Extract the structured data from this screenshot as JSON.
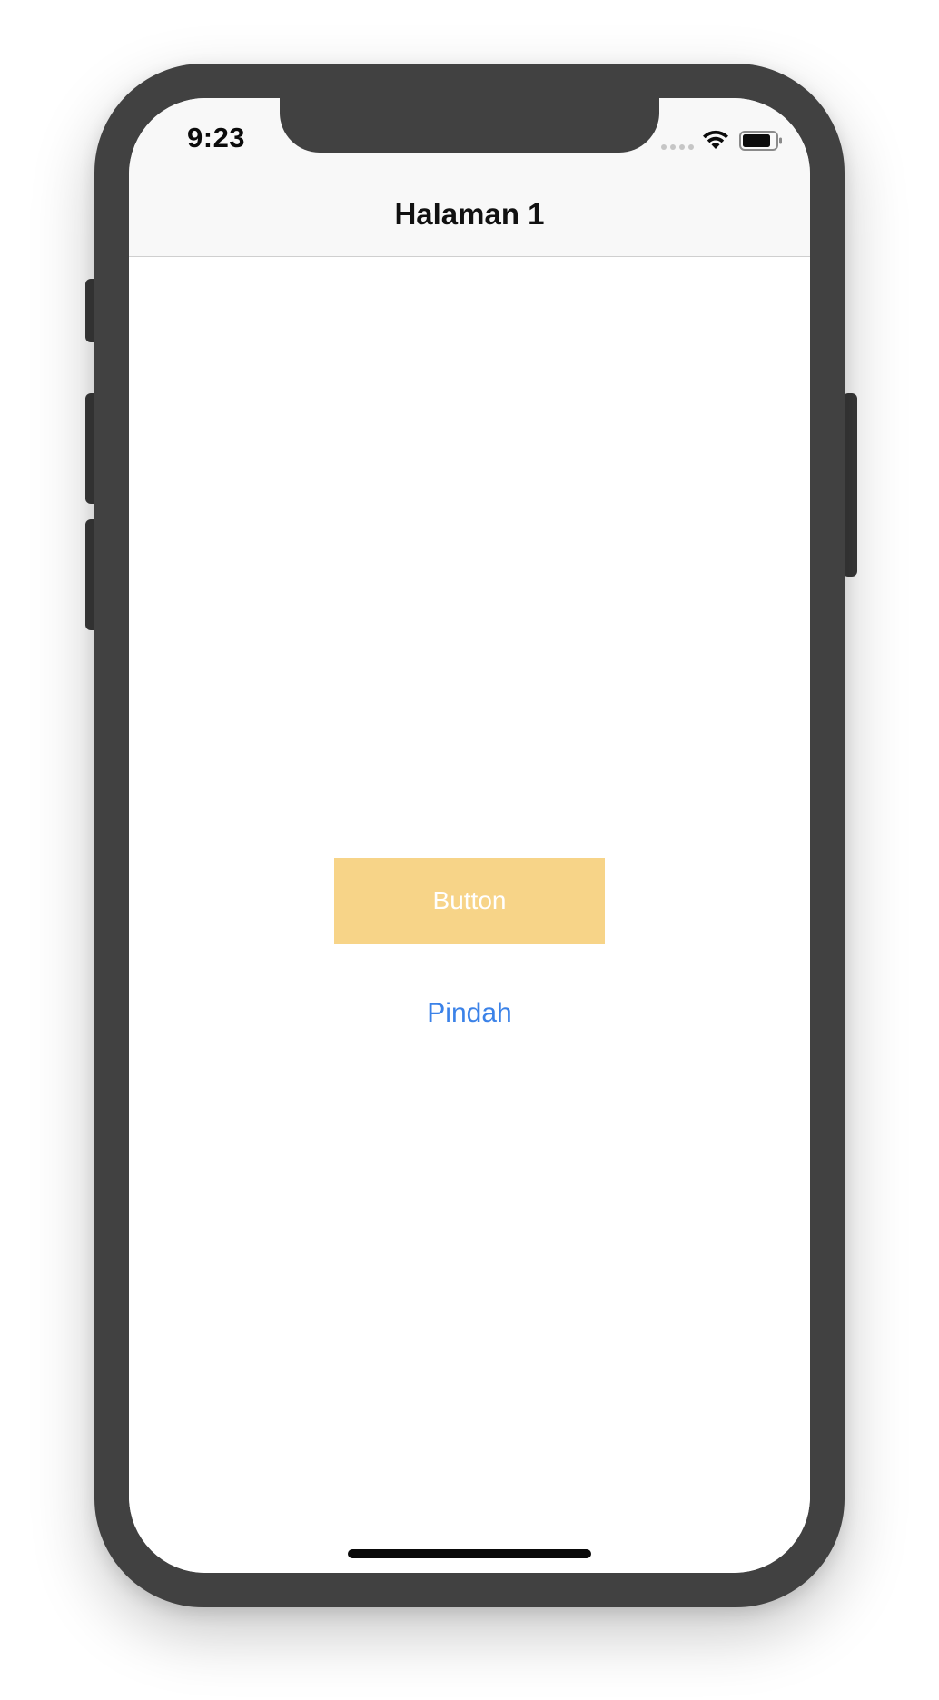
{
  "status_bar": {
    "time": "9:23",
    "wifi_icon": "wifi-icon",
    "battery_icon": "battery-icon"
  },
  "nav": {
    "title": "Halaman 1"
  },
  "main": {
    "primary_button_label": "Button",
    "link_button_label": "Pindah"
  },
  "colors": {
    "frame": "#414141",
    "button_bg": "#f7d488",
    "link": "#3b82e8",
    "nav_bg": "#f8f8f8"
  }
}
